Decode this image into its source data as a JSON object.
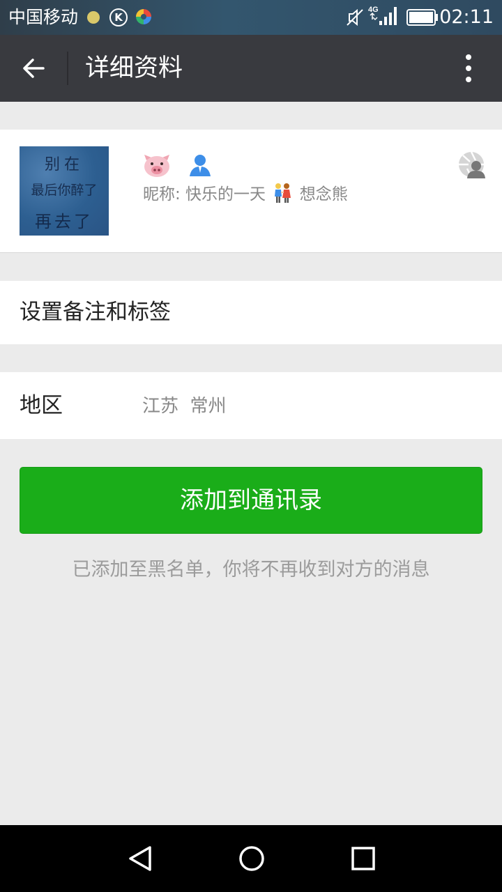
{
  "status_bar": {
    "carrier": "中国移动",
    "k_badge": "K",
    "network": "4G",
    "time": "02:11",
    "icons": [
      "yellow-dot-icon",
      "k-circle-icon",
      "colorful-app-icon",
      "mute-icon",
      "signal-icon",
      "battery-icon"
    ]
  },
  "header": {
    "title": "详细资料",
    "back_icon": "arrow-left-icon",
    "more_icon": "vertical-dots-icon"
  },
  "profile": {
    "avatar_text": [
      "别在",
      "最后你醉了",
      "再去了"
    ],
    "name_emoji": "pig-face-icon",
    "badge_icon": "person-icon",
    "nickname_prefix": "昵称: 快乐的一天",
    "nickname_suffix": "想念熊",
    "nickname_emoji": "couple-holding-hands-icon",
    "moments_icon": "aperture-person-icon"
  },
  "remark": {
    "label": "设置备注和标签"
  },
  "region": {
    "label": "地区",
    "value": "江苏  常州"
  },
  "actions": {
    "add_button": "添加到通讯录",
    "blacklist_note": "已添加至黑名单，你将不再收到对方的消息"
  },
  "nav": {
    "icons": [
      "back-triangle-icon",
      "home-circle-icon",
      "recents-square-icon"
    ]
  },
  "colors": {
    "action_bar": "#393a3f",
    "primary_button": "#1aad19",
    "background": "#ebebeb"
  }
}
